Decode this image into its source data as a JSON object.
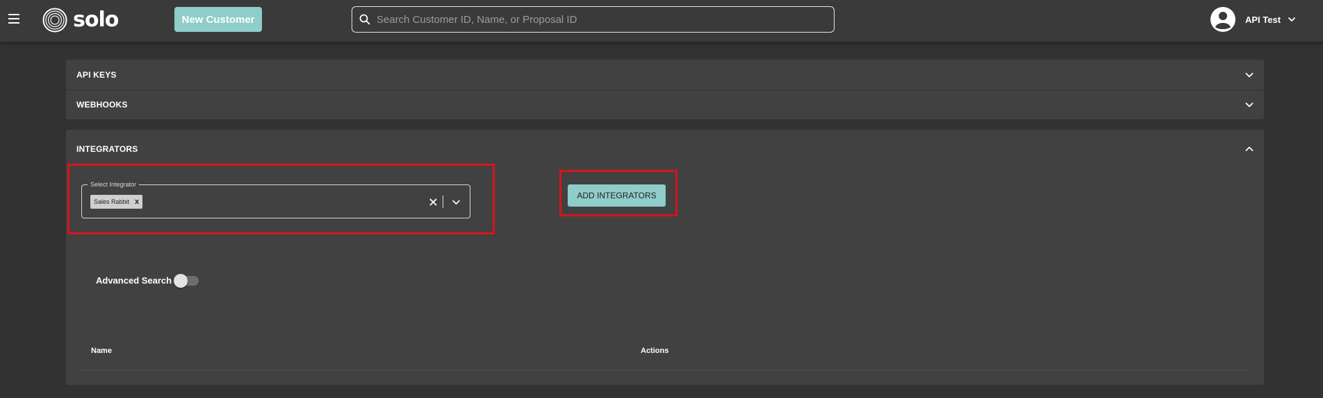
{
  "header": {
    "logo_text": "solo",
    "new_customer_label": "New Customer",
    "search_placeholder": "Search Customer ID, Name, or Proposal ID",
    "search_value": "",
    "user_name": "API Test"
  },
  "sections": {
    "api_keys": {
      "title": "API KEYS",
      "expanded": false
    },
    "webhooks": {
      "title": "WEBHOOKS",
      "expanded": false
    },
    "integrators": {
      "title": "INTEGRATORS",
      "expanded": true
    }
  },
  "integrators": {
    "select_label": "Select Integrator",
    "selected_chip": "Sales Rabbit",
    "chip_remove": "x",
    "add_button_label": "ADD INTEGRATORS",
    "advanced_search_label": "Advanced Search",
    "advanced_search_enabled": false,
    "table": {
      "columns": [
        "Name",
        "Actions"
      ]
    }
  },
  "colors": {
    "accent": "#8ecdc8",
    "highlight": "#d9131d",
    "panel": "#414141",
    "background": "#323232"
  },
  "icons": {
    "menu": "hamburger-icon",
    "logo": "solo-logo-icon",
    "search": "search-icon",
    "avatar": "account-circle-icon",
    "caret": "chevron-down-icon",
    "collapse": "chevron-up-icon",
    "clear": "close-icon"
  }
}
